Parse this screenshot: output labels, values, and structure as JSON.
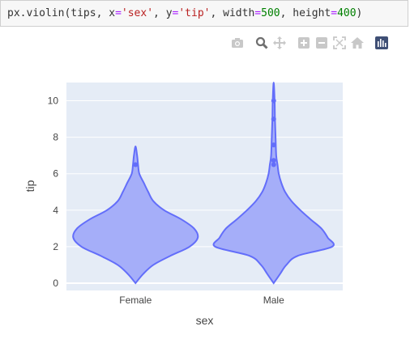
{
  "code": {
    "fn": "px.violin",
    "arg1": "tips",
    "x_kw": "x",
    "x_val": "'sex'",
    "y_kw": "y",
    "y_val": "'tip'",
    "w_kw": "width",
    "w_val": "500",
    "h_kw": "height",
    "h_val": "400"
  },
  "modebar": {
    "icons": [
      "camera-icon",
      "zoom-icon",
      "pan-icon",
      "zoom-in-icon",
      "zoom-out-icon",
      "autoscale-icon",
      "home-icon",
      "plotly-logo-icon"
    ]
  },
  "colors": {
    "plot_bg": "#e5ecf6",
    "violin_fill": "#a5aef9",
    "violin_line": "#636efa",
    "grid": "#ffffff",
    "axis_text": "#444444"
  },
  "chart_data": {
    "type": "violin",
    "xlabel": "sex",
    "ylabel": "tip",
    "categories": [
      "Female",
      "Male"
    ],
    "ylim": [
      -0.4,
      11.0
    ],
    "yticks": [
      0,
      2,
      4,
      6,
      8,
      10
    ],
    "grid": true,
    "violins": [
      {
        "category": "Female",
        "min": 0.0,
        "max": 7.5,
        "profile": [
          [
            0.0,
            0.0
          ],
          [
            0.5,
            0.12
          ],
          [
            1.0,
            0.28
          ],
          [
            1.5,
            0.55
          ],
          [
            2.0,
            0.85
          ],
          [
            2.5,
            0.98
          ],
          [
            3.0,
            0.92
          ],
          [
            3.5,
            0.72
          ],
          [
            4.0,
            0.45
          ],
          [
            4.5,
            0.28
          ],
          [
            5.0,
            0.2
          ],
          [
            5.5,
            0.13
          ],
          [
            6.0,
            0.06
          ],
          [
            6.5,
            0.04
          ],
          [
            7.0,
            0.025
          ],
          [
            7.5,
            0.0
          ]
        ],
        "outliers": [
          6.5
        ]
      },
      {
        "category": "Male",
        "min": 0.0,
        "max": 11.0,
        "profile": [
          [
            0.0,
            0.0
          ],
          [
            0.5,
            0.1
          ],
          [
            1.0,
            0.2
          ],
          [
            1.5,
            0.38
          ],
          [
            2.0,
            0.92
          ],
          [
            2.5,
            0.85
          ],
          [
            3.0,
            0.75
          ],
          [
            3.5,
            0.58
          ],
          [
            4.0,
            0.42
          ],
          [
            4.5,
            0.28
          ],
          [
            5.0,
            0.18
          ],
          [
            5.5,
            0.12
          ],
          [
            6.0,
            0.08
          ],
          [
            6.5,
            0.06
          ],
          [
            7.0,
            0.04
          ],
          [
            8.0,
            0.03
          ],
          [
            9.0,
            0.02
          ],
          [
            10.0,
            0.015
          ],
          [
            11.0,
            0.0
          ]
        ],
        "outliers": [
          6.5,
          6.73,
          7.58,
          9.0,
          10.0
        ]
      }
    ]
  }
}
